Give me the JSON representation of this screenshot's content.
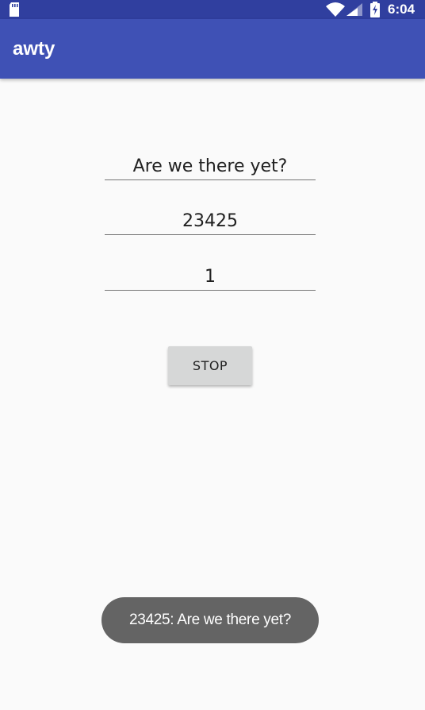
{
  "status_bar": {
    "time": "6:04",
    "icons": [
      "sd-card-icon",
      "wifi-icon",
      "signal-icon",
      "battery-charging-icon"
    ]
  },
  "app_bar": {
    "title": "awty"
  },
  "form": {
    "message_value": "Are we there yet?",
    "phone_value": "23425",
    "interval_value": "1",
    "action_label": "STOP"
  },
  "toast": {
    "text": "23425: Are we there yet?"
  },
  "colors": {
    "status_bar": "#303f9f",
    "app_bar": "#3f51b5",
    "background": "#fafafa",
    "button": "#d6d7d7",
    "toast": "#646464"
  }
}
